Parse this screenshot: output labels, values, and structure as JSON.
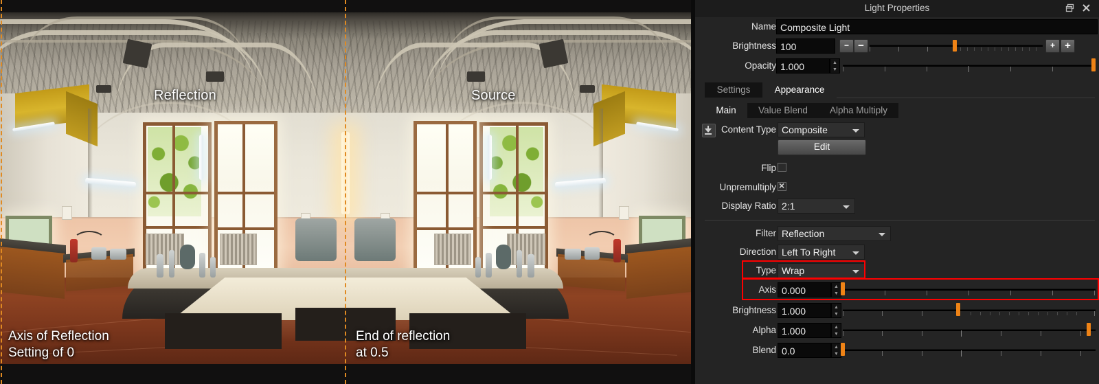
{
  "window": {
    "title": "Light Properties",
    "restore_icon": "restore-window-icon",
    "close_icon": "close-icon"
  },
  "fields": {
    "name_label": "Name",
    "name_value": "Composite Light",
    "brightness_label": "Brightness",
    "brightness_value": "100",
    "opacity_label": "Opacity",
    "opacity_value": "1.000",
    "minus_small": "−",
    "minus_large": "−",
    "plus_small": "+",
    "plus_large": "+"
  },
  "tabs_primary": [
    {
      "label": "Settings",
      "active": false
    },
    {
      "label": "Appearance",
      "active": true
    }
  ],
  "tabs_secondary": [
    {
      "label": "Main",
      "active": true
    },
    {
      "label": "Value Blend",
      "active": false
    },
    {
      "label": "Alpha Multiply",
      "active": false
    }
  ],
  "main": {
    "content_type_label": "Content Type",
    "content_type_value": "Composite",
    "content_type_icon": "download-icon",
    "edit_button": "Edit",
    "flip_label": "Flip",
    "flip_checked": false,
    "unpremultiply_label": "Unpremultiply",
    "unpremultiply_checked": true,
    "display_ratio_label": "Display Ratio",
    "display_ratio_value": "2:1"
  },
  "filter_section": {
    "filter_label": "Filter",
    "filter_value": "Reflection",
    "direction_label": "Direction",
    "direction_value": "Left To Right",
    "type_label": "Type",
    "type_value": "Wrap",
    "axis_label": "Axis",
    "axis_value": "0.000",
    "brightness_label": "Brightness",
    "brightness_value": "1.000",
    "alpha_label": "Alpha",
    "alpha_value": "1.000",
    "blend_label": "Blend",
    "blend_value": "0.0"
  },
  "highlight": {
    "color": "#ff0000",
    "boxes": [
      "type-row",
      "axis-row"
    ]
  },
  "viewport": {
    "label_reflection": "Reflection",
    "label_source": "Source",
    "note_left_line1": "Axis of Reflection",
    "note_left_line2": "Setting of 0",
    "note_right_line1": "End of reflection",
    "note_right_line2": "at 0.5",
    "axis_marker_color": "#e08a22"
  }
}
